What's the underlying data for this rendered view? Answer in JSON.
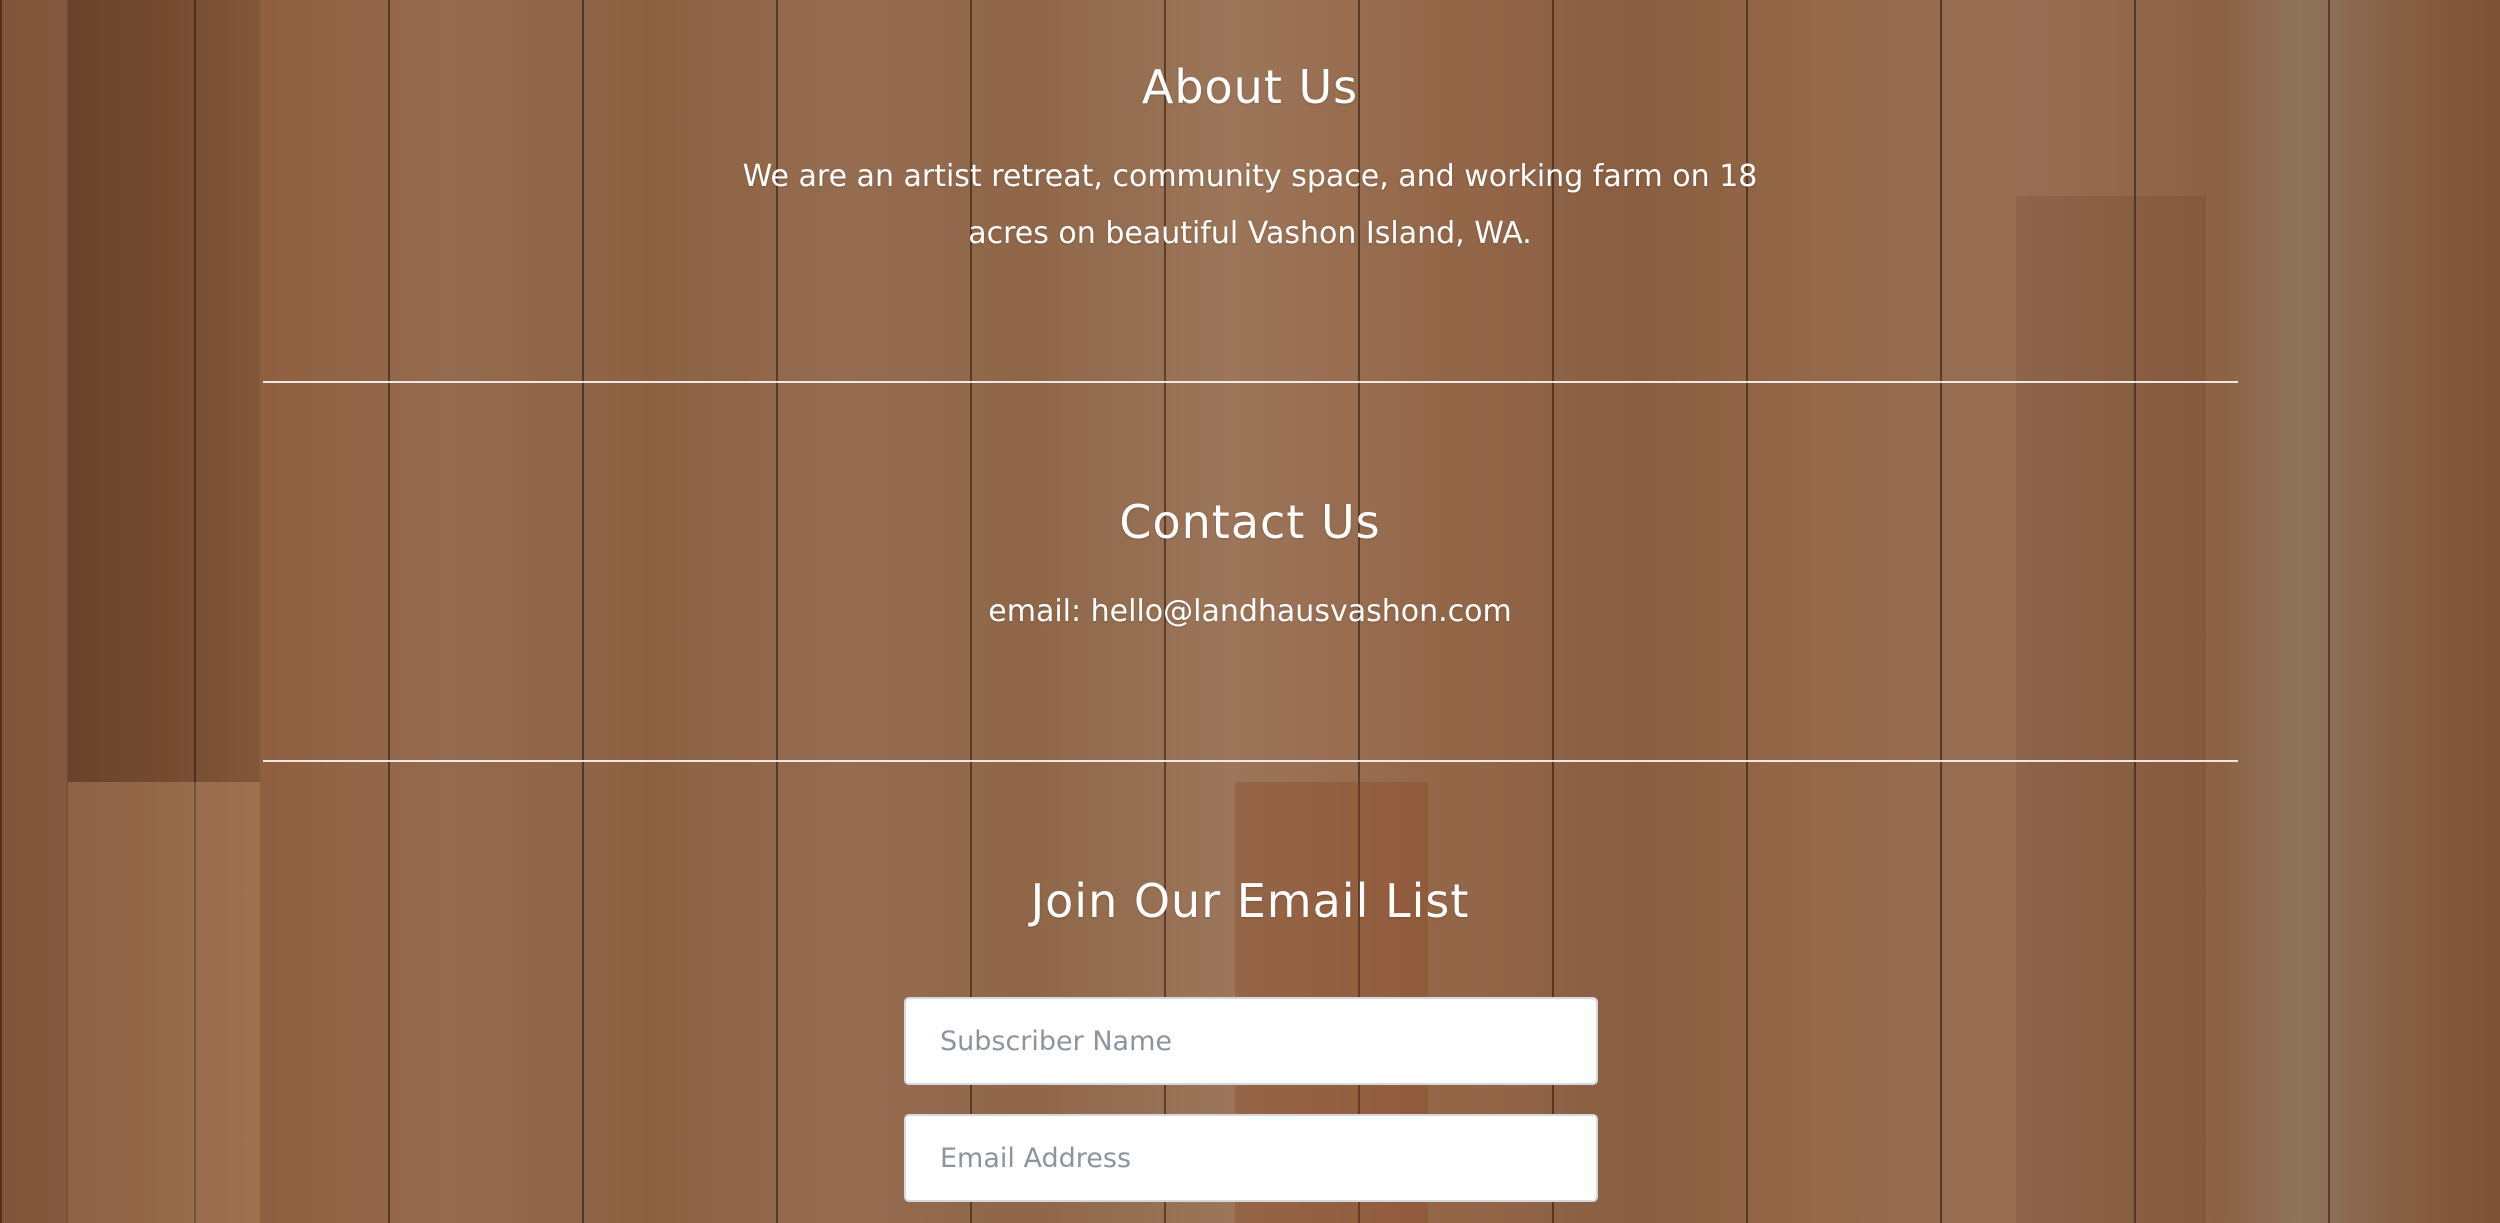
{
  "about": {
    "title": "About Us",
    "text": "We are an artist retreat, community space, and working farm on 18 acres on beautiful Vashon Island, WA."
  },
  "contact": {
    "title": "Contact Us",
    "email_line": "email: hello@landhausvashon.com"
  },
  "signup": {
    "title": "Join Our Email List",
    "name_placeholder": "Subscriber Name",
    "name_value": "",
    "email_placeholder": "Email Address",
    "email_value": ""
  },
  "colors": {
    "text": "#ffffff",
    "divider": "#ffffff",
    "input_background": "#ffffff",
    "placeholder": "#8c959e",
    "wood": "#a47552"
  }
}
